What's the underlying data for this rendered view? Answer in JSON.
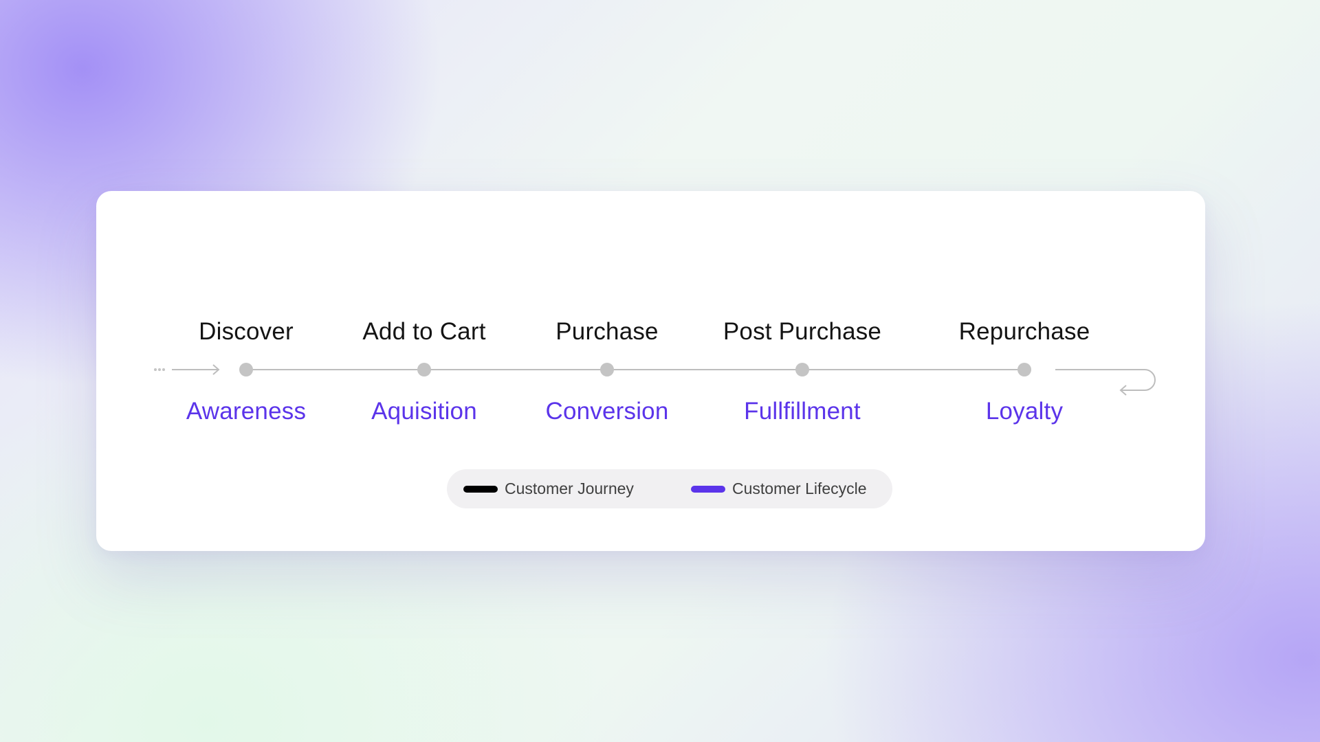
{
  "stages": [
    {
      "journey": "Discover",
      "lifecycle": "Awareness"
    },
    {
      "journey": "Add to Cart",
      "lifecycle": "Aquisition"
    },
    {
      "journey": "Purchase",
      "lifecycle": "Conversion"
    },
    {
      "journey": "Post Purchase",
      "lifecycle": "Fullfillment"
    },
    {
      "journey": "Repurchase",
      "lifecycle": "Loyalty"
    }
  ],
  "legend": {
    "journey_label": "Customer Journey",
    "lifecycle_label": "Customer Lifecycle"
  },
  "colors": {
    "journey": "#000000",
    "lifecycle": "#5b34ea",
    "node": "#c4c4c4",
    "line": "#bdbdbd"
  }
}
